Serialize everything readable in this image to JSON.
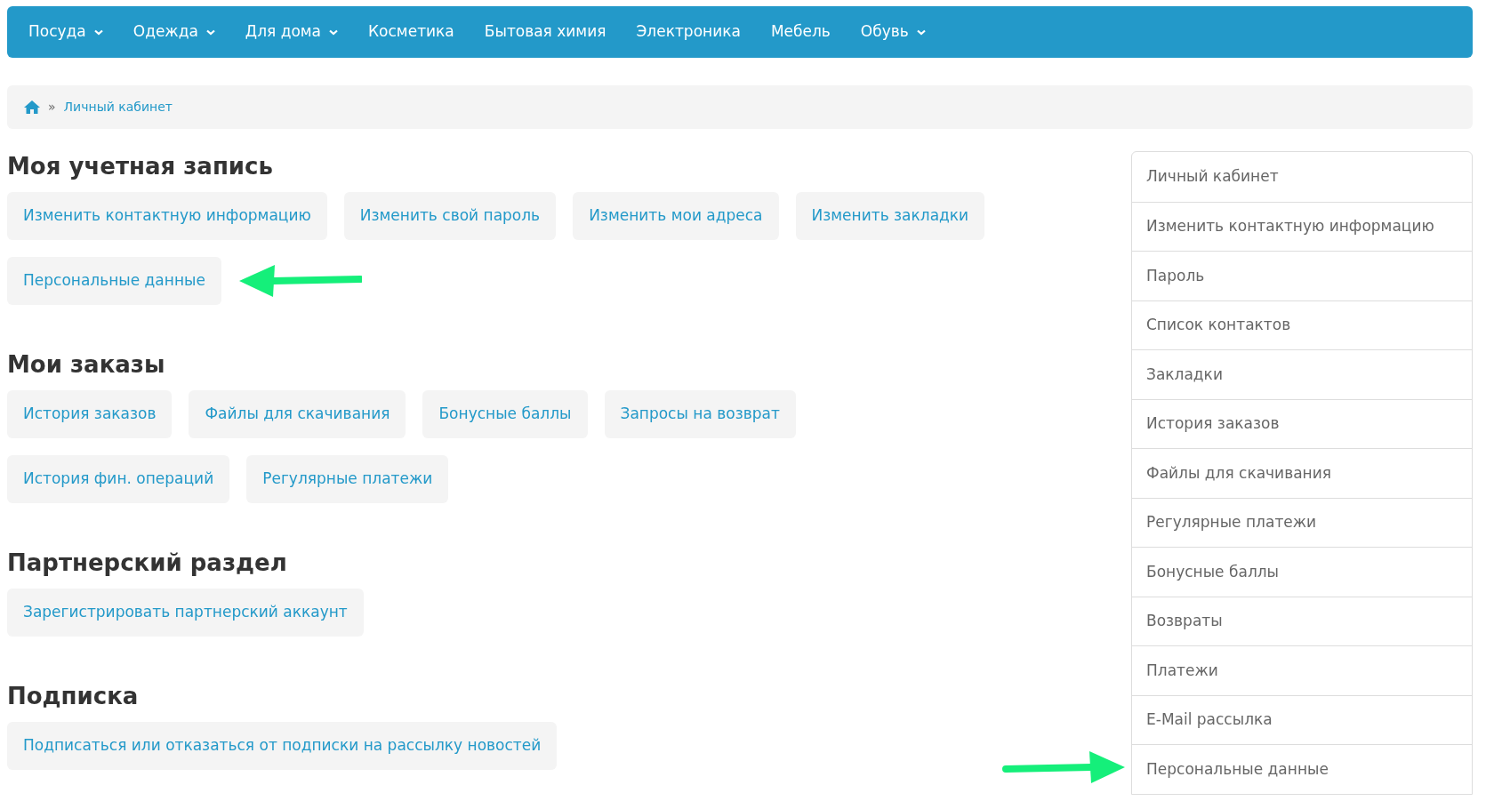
{
  "nav": [
    {
      "label": "Посуда",
      "has_dropdown": true
    },
    {
      "label": "Одежда",
      "has_dropdown": true
    },
    {
      "label": "Для дома",
      "has_dropdown": true
    },
    {
      "label": "Косметика",
      "has_dropdown": false
    },
    {
      "label": "Бытовая химия",
      "has_dropdown": false
    },
    {
      "label": "Электроника",
      "has_dropdown": false
    },
    {
      "label": "Мебель",
      "has_dropdown": false
    },
    {
      "label": "Обувь",
      "has_dropdown": true
    }
  ],
  "breadcrumb": {
    "separator": "»",
    "items": [
      "Личный кабинет"
    ]
  },
  "sections": [
    {
      "title": "Моя учетная запись",
      "links": [
        {
          "label": "Изменить контактную информацию",
          "arrow": false
        },
        {
          "label": "Изменить свой пароль",
          "arrow": false
        },
        {
          "label": "Изменить мои адреса",
          "arrow": false
        },
        {
          "label": "Изменить закладки",
          "arrow": false
        },
        {
          "label": "Персональные данные",
          "arrow": true
        }
      ]
    },
    {
      "title": "Мои заказы",
      "links": [
        {
          "label": "История заказов",
          "arrow": false
        },
        {
          "label": "Файлы для скачивания",
          "arrow": false
        },
        {
          "label": "Бонусные баллы",
          "arrow": false
        },
        {
          "label": "Запросы на возврат",
          "arrow": false
        },
        {
          "label": "История фин. операций",
          "arrow": false
        },
        {
          "label": "Регулярные платежи",
          "arrow": false
        }
      ]
    },
    {
      "title": "Партнерский раздел",
      "links": [
        {
          "label": "Зарегистрировать партнерский аккаунт",
          "arrow": false
        }
      ]
    },
    {
      "title": "Подписка",
      "links": [
        {
          "label": "Подписаться или отказаться от подписки на рассылку новостей",
          "arrow": false
        }
      ]
    }
  ],
  "sidebar": {
    "items": [
      {
        "label": "Личный кабинет",
        "arrow": false
      },
      {
        "label": "Изменить контактную информацию",
        "arrow": false
      },
      {
        "label": "Пароль",
        "arrow": false
      },
      {
        "label": "Список контактов",
        "arrow": false
      },
      {
        "label": "Закладки",
        "arrow": false
      },
      {
        "label": "История заказов",
        "arrow": false
      },
      {
        "label": "Файлы для скачивания",
        "arrow": false
      },
      {
        "label": "Регулярные платежи",
        "arrow": false
      },
      {
        "label": "Бонусные баллы",
        "arrow": false
      },
      {
        "label": "Возвраты",
        "arrow": false
      },
      {
        "label": "Платежи",
        "arrow": false
      },
      {
        "label": "E-Mail рассылка",
        "arrow": false
      },
      {
        "label": "Персональные данные",
        "arrow": true
      }
    ]
  }
}
